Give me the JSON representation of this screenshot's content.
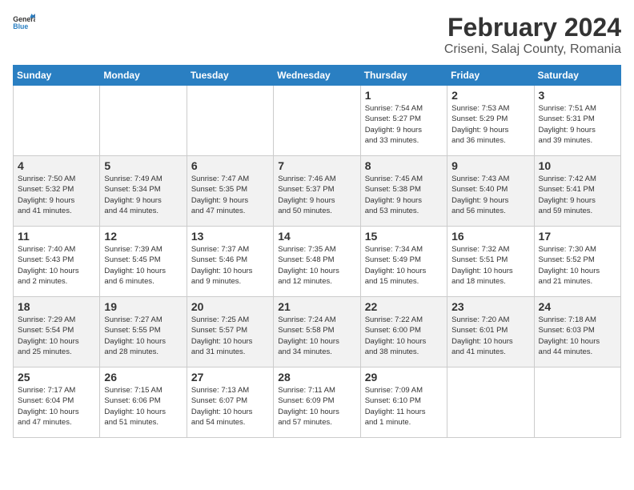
{
  "header": {
    "logo_general": "General",
    "logo_blue": "Blue",
    "month": "February 2024",
    "location": "Criseni, Salaj County, Romania"
  },
  "days_of_week": [
    "Sunday",
    "Monday",
    "Tuesday",
    "Wednesday",
    "Thursday",
    "Friday",
    "Saturday"
  ],
  "weeks": [
    [
      {
        "day": "",
        "info": ""
      },
      {
        "day": "",
        "info": ""
      },
      {
        "day": "",
        "info": ""
      },
      {
        "day": "",
        "info": ""
      },
      {
        "day": "1",
        "info": "Sunrise: 7:54 AM\nSunset: 5:27 PM\nDaylight: 9 hours\nand 33 minutes."
      },
      {
        "day": "2",
        "info": "Sunrise: 7:53 AM\nSunset: 5:29 PM\nDaylight: 9 hours\nand 36 minutes."
      },
      {
        "day": "3",
        "info": "Sunrise: 7:51 AM\nSunset: 5:31 PM\nDaylight: 9 hours\nand 39 minutes."
      }
    ],
    [
      {
        "day": "4",
        "info": "Sunrise: 7:50 AM\nSunset: 5:32 PM\nDaylight: 9 hours\nand 41 minutes."
      },
      {
        "day": "5",
        "info": "Sunrise: 7:49 AM\nSunset: 5:34 PM\nDaylight: 9 hours\nand 44 minutes."
      },
      {
        "day": "6",
        "info": "Sunrise: 7:47 AM\nSunset: 5:35 PM\nDaylight: 9 hours\nand 47 minutes."
      },
      {
        "day": "7",
        "info": "Sunrise: 7:46 AM\nSunset: 5:37 PM\nDaylight: 9 hours\nand 50 minutes."
      },
      {
        "day": "8",
        "info": "Sunrise: 7:45 AM\nSunset: 5:38 PM\nDaylight: 9 hours\nand 53 minutes."
      },
      {
        "day": "9",
        "info": "Sunrise: 7:43 AM\nSunset: 5:40 PM\nDaylight: 9 hours\nand 56 minutes."
      },
      {
        "day": "10",
        "info": "Sunrise: 7:42 AM\nSunset: 5:41 PM\nDaylight: 9 hours\nand 59 minutes."
      }
    ],
    [
      {
        "day": "11",
        "info": "Sunrise: 7:40 AM\nSunset: 5:43 PM\nDaylight: 10 hours\nand 2 minutes."
      },
      {
        "day": "12",
        "info": "Sunrise: 7:39 AM\nSunset: 5:45 PM\nDaylight: 10 hours\nand 6 minutes."
      },
      {
        "day": "13",
        "info": "Sunrise: 7:37 AM\nSunset: 5:46 PM\nDaylight: 10 hours\nand 9 minutes."
      },
      {
        "day": "14",
        "info": "Sunrise: 7:35 AM\nSunset: 5:48 PM\nDaylight: 10 hours\nand 12 minutes."
      },
      {
        "day": "15",
        "info": "Sunrise: 7:34 AM\nSunset: 5:49 PM\nDaylight: 10 hours\nand 15 minutes."
      },
      {
        "day": "16",
        "info": "Sunrise: 7:32 AM\nSunset: 5:51 PM\nDaylight: 10 hours\nand 18 minutes."
      },
      {
        "day": "17",
        "info": "Sunrise: 7:30 AM\nSunset: 5:52 PM\nDaylight: 10 hours\nand 21 minutes."
      }
    ],
    [
      {
        "day": "18",
        "info": "Sunrise: 7:29 AM\nSunset: 5:54 PM\nDaylight: 10 hours\nand 25 minutes."
      },
      {
        "day": "19",
        "info": "Sunrise: 7:27 AM\nSunset: 5:55 PM\nDaylight: 10 hours\nand 28 minutes."
      },
      {
        "day": "20",
        "info": "Sunrise: 7:25 AM\nSunset: 5:57 PM\nDaylight: 10 hours\nand 31 minutes."
      },
      {
        "day": "21",
        "info": "Sunrise: 7:24 AM\nSunset: 5:58 PM\nDaylight: 10 hours\nand 34 minutes."
      },
      {
        "day": "22",
        "info": "Sunrise: 7:22 AM\nSunset: 6:00 PM\nDaylight: 10 hours\nand 38 minutes."
      },
      {
        "day": "23",
        "info": "Sunrise: 7:20 AM\nSunset: 6:01 PM\nDaylight: 10 hours\nand 41 minutes."
      },
      {
        "day": "24",
        "info": "Sunrise: 7:18 AM\nSunset: 6:03 PM\nDaylight: 10 hours\nand 44 minutes."
      }
    ],
    [
      {
        "day": "25",
        "info": "Sunrise: 7:17 AM\nSunset: 6:04 PM\nDaylight: 10 hours\nand 47 minutes."
      },
      {
        "day": "26",
        "info": "Sunrise: 7:15 AM\nSunset: 6:06 PM\nDaylight: 10 hours\nand 51 minutes."
      },
      {
        "day": "27",
        "info": "Sunrise: 7:13 AM\nSunset: 6:07 PM\nDaylight: 10 hours\nand 54 minutes."
      },
      {
        "day": "28",
        "info": "Sunrise: 7:11 AM\nSunset: 6:09 PM\nDaylight: 10 hours\nand 57 minutes."
      },
      {
        "day": "29",
        "info": "Sunrise: 7:09 AM\nSunset: 6:10 PM\nDaylight: 11 hours\nand 1 minute."
      },
      {
        "day": "",
        "info": ""
      },
      {
        "day": "",
        "info": ""
      }
    ]
  ]
}
